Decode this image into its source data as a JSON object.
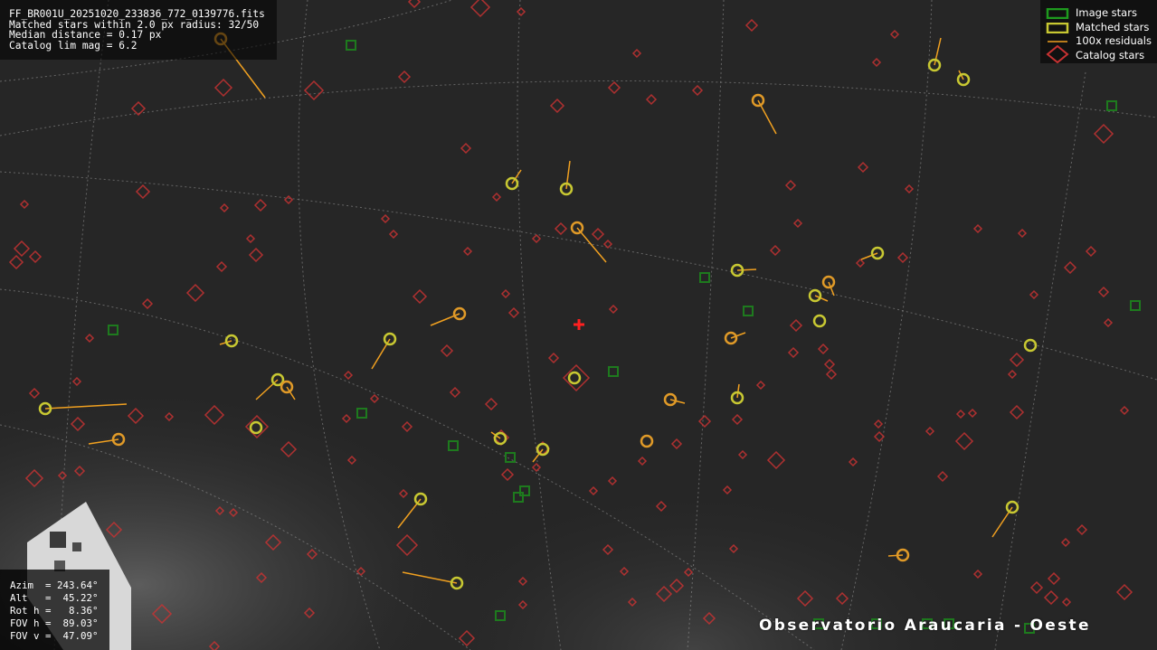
{
  "info": {
    "filename": "FF_BR001U_20251020_233836_772_0139776.fits",
    "matched": "Matched stars within 2.0 px radius: 32/50",
    "median": "Median distance = 0.17 px",
    "catalog_lim": "Catalog lim mag = 6.2"
  },
  "legend": {
    "image_stars": "Image stars",
    "matched_stars": "Matched stars",
    "residuals": "100x residuals",
    "catalog_stars": "Catalog stars"
  },
  "pointing": {
    "azim": "Azim  = 243.64°",
    "alt": "Alt   =  45.22°",
    "rot": "Rot h =   8.36°",
    "fov_h": "FOV h =  89.03°",
    "fov_v": "FOV v =  47.09°"
  },
  "caption": "Observatorio Araucaria - Oeste",
  "colors": {
    "background": "#1c1c1c",
    "image_star": "#1e7a1e",
    "matched_star": "#c8c832",
    "matched_star_alt": "#e09a28",
    "residual": "#f0a020",
    "catalog_star": "#c83232",
    "grid": "#9a9a9a",
    "center_marker": "#ff2020"
  }
}
